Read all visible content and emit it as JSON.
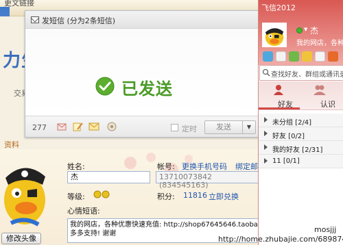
{
  "background_window": {
    "top_text": "更文链接",
    "big_text": "力生",
    "small_text": "交易",
    "link_text": "资料"
  },
  "profile": {
    "change_avatar_label": "修改头像",
    "name_label": "姓名:",
    "name_value": "杰",
    "account_label": "帐号:",
    "change_phone_link": "更换手机号码",
    "bind_email_link": "绑定邮",
    "account_value": "13710073842 (834545163)",
    "level_label": "等级:",
    "points_label": "积分:",
    "points_value": "11816",
    "redeem_link": "立即兑换",
    "mood_label": "心情短语:",
    "mood_text_line1": "我的网店，各种优惠快速充值: http://shop67645646.taoba",
    "mood_text_line2": "多多支持! 谢谢"
  },
  "sms_dialog": {
    "title": "发短信 (分为2条短信)",
    "sent_text": "已发送",
    "char_count": "277",
    "timer_label": "定时",
    "send_label": "发送",
    "dropdown_glyph": "▼"
  },
  "fetion": {
    "title": "飞信2012",
    "status_caret": "▼",
    "user_name": "杰",
    "user_status": "我的网店，各种",
    "search_placeholder": "查找好友、群组或通讯录",
    "tabs": [
      {
        "label": "好友",
        "active": true
      },
      {
        "label": "认识"
      }
    ],
    "groups": [
      {
        "label": "未分组 [2/4]"
      },
      {
        "label": "好友 [0/2]"
      },
      {
        "label": "我的好友 [2/31]"
      },
      {
        "label": "11 [0/1]"
      }
    ],
    "colors": {
      "accent": "#d95853",
      "online": "#3fb52e"
    }
  },
  "watermark": {
    "user": "mosjjj",
    "url": "http://home.zhubajie.com/6898743/"
  },
  "icons": [
    "message-icon",
    "check-circle-icon",
    "send-card-icon",
    "edit-icon",
    "envelope-icon",
    "settings-icon",
    "search-icon",
    "person-icon",
    "group-icon",
    "home-icon",
    "chat-icon"
  ]
}
